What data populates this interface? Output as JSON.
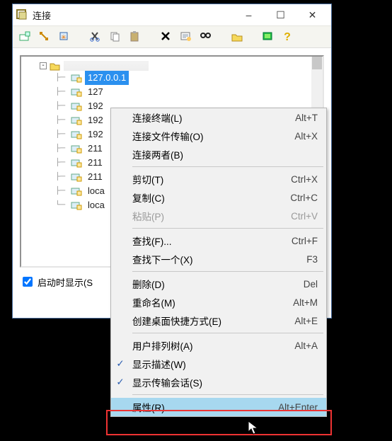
{
  "window": {
    "title": "连接",
    "minimize": "–",
    "maximize": "☐",
    "close": "✕"
  },
  "toolbar": [
    "new-session",
    "quick-connect",
    "new",
    "cut",
    "copy",
    "paste",
    "delete",
    "properties",
    "find",
    "open-folder",
    "options",
    "help"
  ],
  "tree": {
    "root_label": "",
    "items": [
      {
        "label": "127.0.0.1",
        "selected": true
      },
      {
        "label": "127"
      },
      {
        "label": "192"
      },
      {
        "label": "192"
      },
      {
        "label": "192"
      },
      {
        "label": "211"
      },
      {
        "label": "211"
      },
      {
        "label": "211"
      },
      {
        "label": "loca"
      },
      {
        "label": "loca"
      }
    ]
  },
  "checkbox": {
    "label": "启动时显示(S"
  },
  "context_menu": {
    "groups": [
      [
        {
          "label": "连接终端(L)",
          "shortcut": "Alt+T"
        },
        {
          "label": "连接文件传输(O)",
          "shortcut": "Alt+X"
        },
        {
          "label": "连接两者(B)",
          "shortcut": ""
        }
      ],
      [
        {
          "label": "剪切(T)",
          "shortcut": "Ctrl+X"
        },
        {
          "label": "复制(C)",
          "shortcut": "Ctrl+C"
        },
        {
          "label": "粘贴(P)",
          "shortcut": "Ctrl+V",
          "disabled": true
        }
      ],
      [
        {
          "label": "查找(F)...",
          "shortcut": "Ctrl+F"
        },
        {
          "label": "查找下一个(X)",
          "shortcut": "F3"
        }
      ],
      [
        {
          "label": "删除(D)",
          "shortcut": "Del"
        },
        {
          "label": "重命名(M)",
          "shortcut": "Alt+M"
        },
        {
          "label": "创建桌面快捷方式(E)",
          "shortcut": "Alt+E"
        }
      ],
      [
        {
          "label": "用户排列树(A)",
          "shortcut": "Alt+A"
        },
        {
          "label": "显示描述(W)",
          "shortcut": "",
          "checked": true
        },
        {
          "label": "显示传输会话(S)",
          "shortcut": "",
          "checked": true
        }
      ],
      [
        {
          "label": "属性(R)",
          "shortcut": "Alt+Enter",
          "highlight": true
        }
      ]
    ]
  }
}
